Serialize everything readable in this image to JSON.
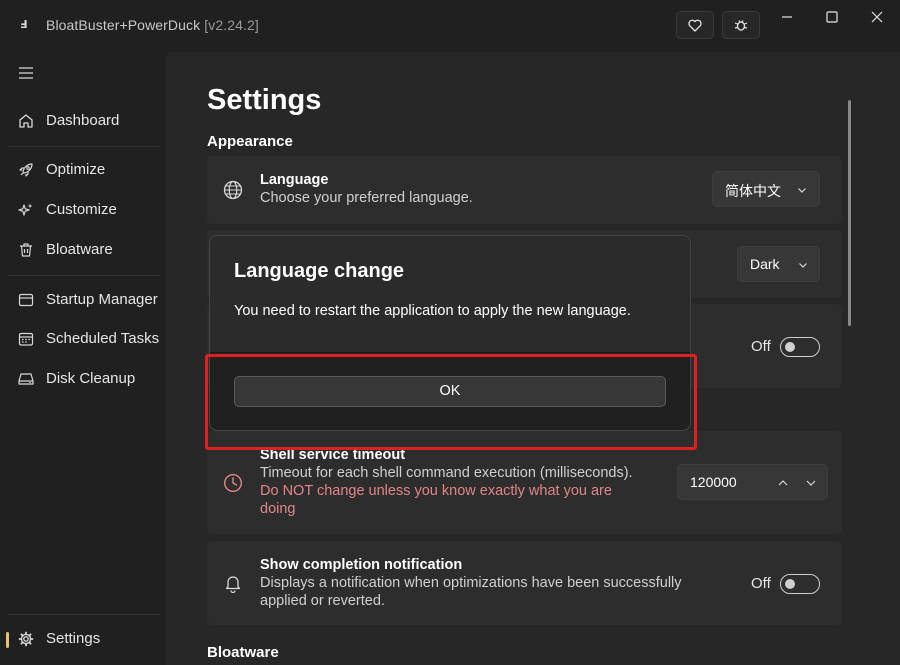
{
  "app": {
    "title": "BloatBuster+PowerDuck",
    "version": "[v2.24.2]",
    "logo_glyph": "Ⅎ"
  },
  "titlebar": {
    "heart_icon": "heart-icon",
    "bug_icon": "bug-icon",
    "minimize_icon": "minimize-icon",
    "maximize_icon": "maximize-icon",
    "close_icon": "close-icon"
  },
  "sidebar": {
    "menu_icon": "hamburger-icon",
    "items": [
      {
        "label": "Dashboard",
        "icon": "home-icon"
      },
      {
        "label": "Optimize",
        "icon": "rocket-icon"
      },
      {
        "label": "Customize",
        "icon": "sparkle-icon"
      },
      {
        "label": "Bloatware",
        "icon": "trash-icon"
      },
      {
        "label": "Startup Manager",
        "icon": "startup-icon"
      },
      {
        "label": "Scheduled Tasks",
        "icon": "calendar-icon"
      },
      {
        "label": "Disk Cleanup",
        "icon": "disk-icon"
      }
    ],
    "settings": {
      "label": "Settings",
      "icon": "gear-icon",
      "active": true
    },
    "accent_color": "#e8c16a"
  },
  "settings": {
    "page_title": "Settings",
    "appearance_section": "Appearance",
    "language": {
      "title": "Language",
      "description": "Choose your preferred language.",
      "value": "简体中文",
      "icon": "globe-icon"
    },
    "theme": {
      "value": "Dark"
    },
    "toggle_row": {
      "value": "Off"
    },
    "shell_timeout": {
      "title": "Shell service timeout",
      "description": "Timeout for each shell command execution (milliseconds).",
      "warning_line1": "Do NOT change unless you know exactly what you are",
      "warning_line2": "doing",
      "value": "120000",
      "icon": "clock-icon",
      "warning_color": "#e0868a"
    },
    "completion_notification": {
      "title": "Show completion notification",
      "description_line1": "Displays a notification when optimizations have been successfully",
      "description_line2": "applied or reverted.",
      "value": "Off",
      "icon": "bell-icon"
    },
    "bloatware_section": "Bloatware"
  },
  "dialog": {
    "title": "Language change",
    "message": "You need to restart the application to apply the new language.",
    "ok_label": "OK",
    "highlight_color": "#e02020"
  }
}
